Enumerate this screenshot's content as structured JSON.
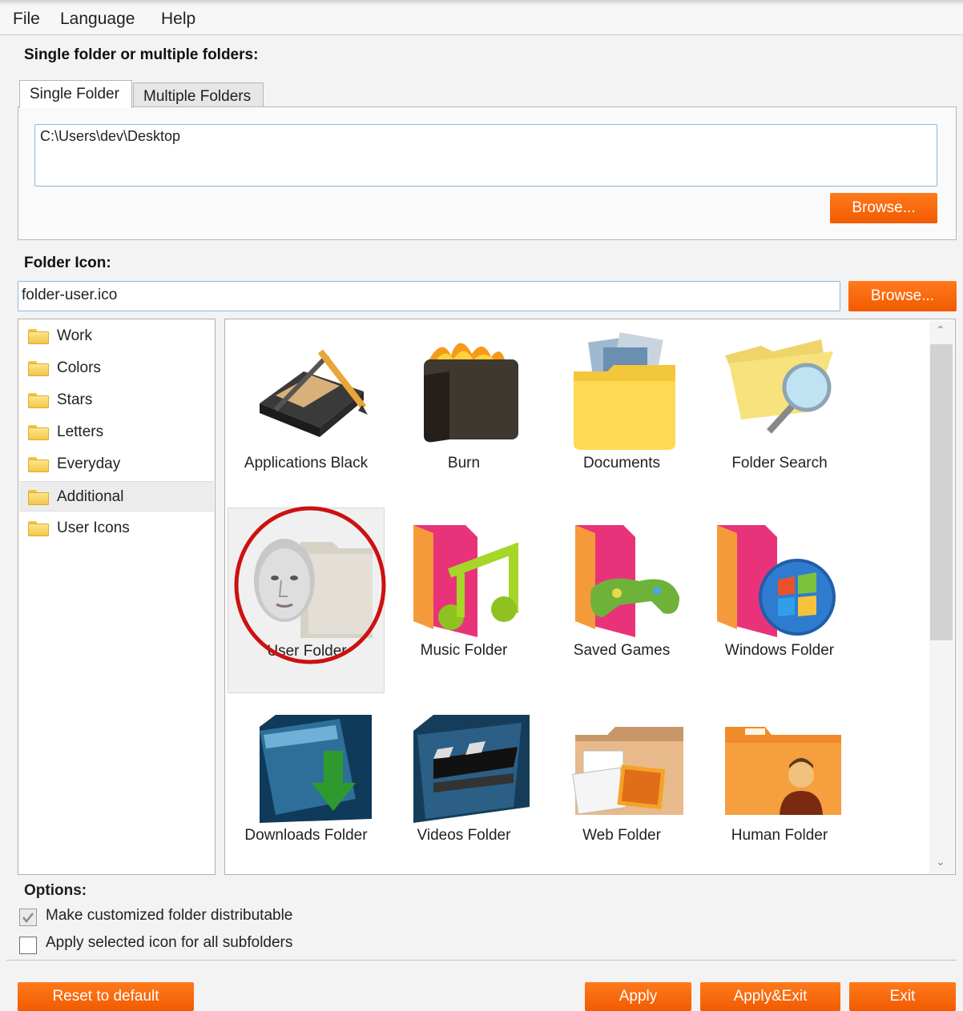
{
  "menu": [
    "File",
    "Language",
    "Help"
  ],
  "folders_section": {
    "label": "Single folder or multiple folders:",
    "tabs": [
      "Single Folder",
      "Multiple Folders"
    ],
    "path": "C:\\Users\\dev\\Desktop",
    "browse_label": "Browse..."
  },
  "icon_section": {
    "label": "Folder Icon:",
    "value": "folder-user.ico",
    "browse_label": "Browse..."
  },
  "categories": [
    "Work",
    "Colors",
    "Stars",
    "Letters",
    "Everyday",
    "Additional",
    "User Icons"
  ],
  "selected_category": "Additional",
  "icons": [
    {
      "label": "Applications Black"
    },
    {
      "label": "Burn"
    },
    {
      "label": "Documents"
    },
    {
      "label": "Folder Search"
    },
    {
      "label": "User Folder"
    },
    {
      "label": "Music Folder"
    },
    {
      "label": "Saved Games"
    },
    {
      "label": "Windows Folder"
    },
    {
      "label": "Downloads Folder"
    },
    {
      "label": "Videos Folder"
    },
    {
      "label": "Web Folder"
    },
    {
      "label": "Human Folder"
    }
  ],
  "selected_icon": "User Folder",
  "options": {
    "label": "Options:",
    "items": [
      {
        "label": "Make customized folder distributable",
        "checked": true
      },
      {
        "label": "Apply selected icon for all subfolders",
        "checked": false
      }
    ]
  },
  "buttons": {
    "reset": "Reset to default",
    "apply": "Apply",
    "apply_exit": "Apply&Exit",
    "exit": "Exit"
  },
  "colors": {
    "accent": "#f46a0c",
    "selection_circle": "#cc1111"
  }
}
